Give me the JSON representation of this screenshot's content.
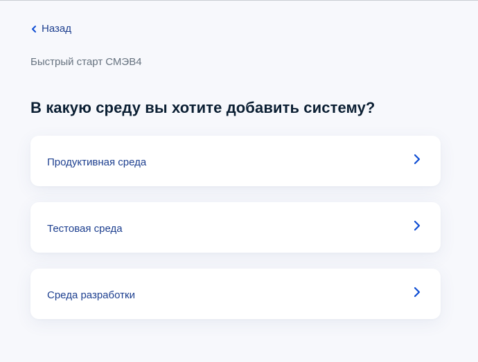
{
  "back": {
    "label": "Назад",
    "icon": "chevron-left-icon"
  },
  "subtitle": "Быстрый старт СМЭВ4",
  "title": "В какую среду вы хотите добавить систему?",
  "options": [
    {
      "label": "Продуктивная среда",
      "icon": "chevron-right-icon"
    },
    {
      "label": "Тестовая среда",
      "icon": "chevron-right-icon"
    },
    {
      "label": "Среда разработки",
      "icon": "chevron-right-icon"
    }
  ],
  "colors": {
    "accent": "#0d4cd3",
    "link_text": "#1d3f8f",
    "title": "#0b1f33",
    "muted": "#66727f",
    "background": "#f7f8fc",
    "card": "#ffffff"
  }
}
